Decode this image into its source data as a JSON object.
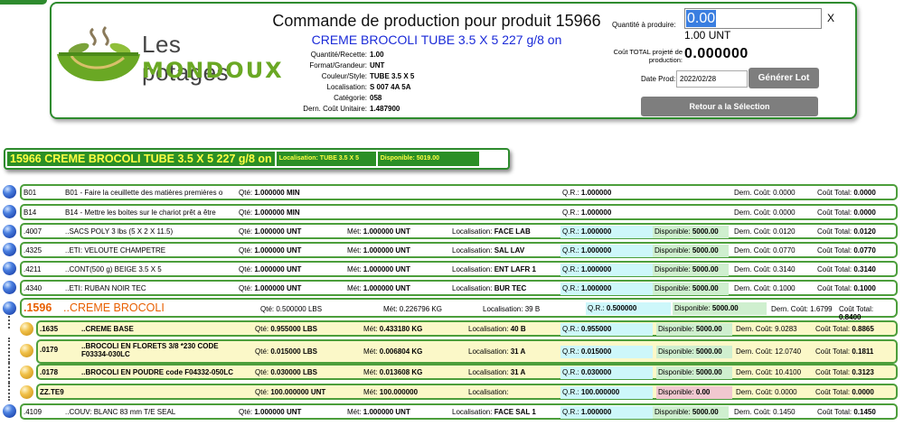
{
  "header": {
    "title": "Commande de production pour produit  15966",
    "product_name": "CREME BROCOLI TUBE 3.5 X 5 227 g/8 on",
    "logo_line1": "Les potages",
    "logo_line2": "MONDOUX",
    "info": [
      {
        "label": "Quantité/Recette:",
        "value": "1.00"
      },
      {
        "label": "Format/Grandeur:",
        "value": "UNT"
      },
      {
        "label": "Couleur/Style:",
        "value": "TUBE 3.5 X 5"
      },
      {
        "label": "Localisation:",
        "value": "S 007 4A 5A"
      },
      {
        "label": "Catégorie:",
        "value": "058"
      },
      {
        "label": "Dern. Coût Unitaire:",
        "value": "1.487900"
      }
    ],
    "qty_label": "Quantité à produire:",
    "qty_value": "0.00",
    "qty_clear": "X",
    "qty_unit": "1.00 UNT",
    "cost_label": "Coût TOTAL projeté de production:",
    "cost_value": "0.000000",
    "date_label": "Date Prod:",
    "date_value": "2022/02/28",
    "generate_button": "Générer Lot",
    "back_button": "Retour a la Sélection"
  },
  "summary": {
    "title": "15966 CREME BROCOLI TUBE 3.5 X 5 227 g/8 on",
    "location": "Localisation: TUBE 3.5 X 5",
    "available": "Disponible: 5019.00"
  },
  "labels": {
    "qte": "Qté:",
    "met": "Mét:",
    "loc": "Localisation:",
    "qr": "Q.R.:",
    "disp": "Disponible:",
    "dern": "Dern. Coût:",
    "total": "Coût Total:"
  },
  "lines": [
    {
      "code": "B01",
      "desc": "B01 - Faire la ceuillette des matières premières o",
      "qte": "1.000000 MIN",
      "met": "",
      "loc": "",
      "qr": "1.000000",
      "disp": "",
      "dern": "0.0000",
      "total": "0.0000"
    },
    {
      "code": "B14",
      "desc": "B14 - Mettre les boites sur le chariot prêt a être",
      "qte": "1.000000 MIN",
      "met": "",
      "loc": "",
      "qr": "1.000000",
      "disp": "",
      "dern": "0.0000",
      "total": "0.0000"
    },
    {
      "code": ".4007",
      "desc": "..SACS POLY 3 lbs (5 X 2 X 11.5)",
      "qte": "1.000000 UNT",
      "met": "1.000000 UNT",
      "loc": "FACE LAB",
      "qr": "1.000000",
      "disp": "5000.00",
      "dern": "0.0120",
      "total": "0.0120"
    },
    {
      "code": ".4325",
      "desc": "..ETI: VELOUTE CHAMPETRE",
      "qte": "1.000000 UNT",
      "met": "1.000000 UNT",
      "loc": "SAL LAV",
      "qr": "1.000000",
      "disp": "5000.00",
      "dern": "0.0770",
      "total": "0.0770"
    },
    {
      "code": ".4211",
      "desc": "..CONT(500 g) BEIGE 3.5 X 5",
      "qte": "1.000000 UNT",
      "met": "1.000000 UNT",
      "loc": "ENT LAFR 1",
      "qr": "1.000000",
      "disp": "5000.00",
      "dern": "0.3140",
      "total": "0.3140"
    },
    {
      "code": ".4340",
      "desc": "..ETI: RUBAN NOIR TEC",
      "qte": "1.000000 UNT",
      "met": "1.000000 UNT",
      "loc": "BUR TEC",
      "qr": "1.000000",
      "disp": "5000.00",
      "dern": "0.1000",
      "total": "0.1000"
    }
  ],
  "group": {
    "code": ".1596",
    "desc": "..CREME BROCOLI",
    "qte": "0.500000 LBS",
    "met": "0.226796 KG",
    "loc": "39 B",
    "qr": "0.500000",
    "disp": "5000.00",
    "dern": "1.6799",
    "total": "0.8400"
  },
  "sublines": [
    {
      "code": ".1635",
      "desc": "..CREME BASE",
      "qte": "0.955000 LBS",
      "met": "0.433180 KG",
      "loc": "40 B",
      "qr": "0.955000",
      "disp": "5000.00",
      "dern": "9.0283",
      "total": "0.8865"
    },
    {
      "code": ".0179",
      "desc": "..BROCOLI EN FLORETS 3/8 *230 CODE F03334-030LC",
      "qte": "0.015000 LBS",
      "met": "0.006804 KG",
      "loc": "31 A",
      "qr": "0.015000",
      "disp": "5000.00",
      "dern": "12.0740",
      "total": "0.1811"
    },
    {
      "code": ".0178",
      "desc": "..BROCOLI EN POUDRE code F04332-050LC",
      "qte": "0.030000 LBS",
      "met": "0.013608 KG",
      "loc": "31 A",
      "qr": "0.030000",
      "disp": "5000.00",
      "dern": "10.4100",
      "total": "0.3123"
    },
    {
      "code": "ZZ.TE9",
      "desc": "",
      "qte": "100.000000 UNT",
      "met": "100.000000",
      "loc": "",
      "qr": "100.000000",
      "disp": "0.00",
      "dern": "0.0000",
      "total": "0.0000"
    }
  ],
  "last_line": {
    "code": ".4109",
    "desc": "..COUV: BLANC 83 mm T/E SEAL",
    "qte": "1.000000 UNT",
    "met": "1.000000 UNT",
    "loc": "FACE SAL 1",
    "qr": "1.000000",
    "disp": "5000.00",
    "dern": "0.1450",
    "total": "0.1450"
  }
}
